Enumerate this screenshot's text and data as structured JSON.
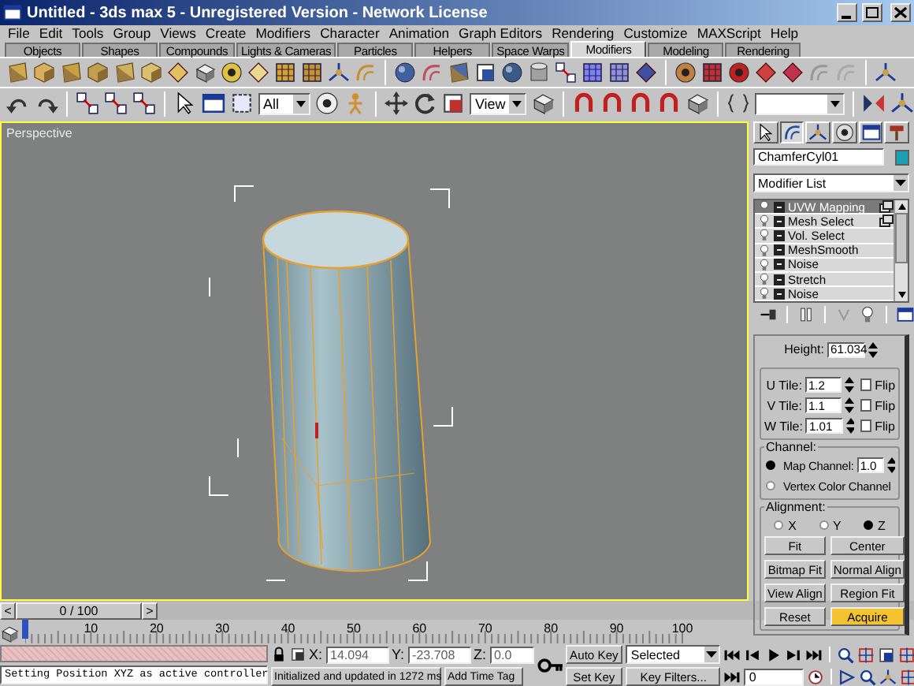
{
  "window": {
    "title": "Untitled - 3ds max 5 - Unregistered Version - Network License"
  },
  "menu": [
    "File",
    "Edit",
    "Tools",
    "Group",
    "Views",
    "Create",
    "Modifiers",
    "Character",
    "Animation",
    "Graph Editors",
    "Rendering",
    "Customize",
    "MAXScript",
    "Help"
  ],
  "tabs": [
    {
      "label": "Objects",
      "selected": false
    },
    {
      "label": "Shapes",
      "selected": false
    },
    {
      "label": "Compounds",
      "selected": false
    },
    {
      "label": "Lights & Cameras",
      "selected": false
    },
    {
      "label": "Particles",
      "selected": false
    },
    {
      "label": "Helpers",
      "selected": false
    },
    {
      "label": "Space Warps",
      "selected": false
    },
    {
      "label": "Modifiers",
      "selected": true
    },
    {
      "label": "Modeling",
      "selected": false
    },
    {
      "label": "Rendering",
      "selected": false
    }
  ],
  "main_toolbar": {
    "selection_filter": "All",
    "coordinate_system": "View"
  },
  "viewport": {
    "label": "Perspective",
    "active": true
  },
  "command_panel": {
    "object": {
      "name": "ChamferCyl01",
      "color": "#1aa0b4"
    },
    "modifier_list": "Modifier List",
    "stack": [
      {
        "name": "UVW Mapping",
        "selected": true,
        "instanced": true
      },
      {
        "name": "Mesh Select",
        "selected": false,
        "instanced": true
      },
      {
        "name": "Vol. Select",
        "selected": false,
        "instanced": false
      },
      {
        "name": "MeshSmooth",
        "selected": false,
        "instanced": false
      },
      {
        "name": "Noise",
        "selected": false,
        "instanced": false
      },
      {
        "name": "Stretch",
        "selected": false,
        "instanced": false
      },
      {
        "name": "Noise",
        "selected": false,
        "instanced": false
      }
    ],
    "height": {
      "label": "Height:",
      "value": "61.034"
    },
    "tiles": [
      {
        "label": "U Tile:",
        "value": "1.2",
        "flip_label": "Flip",
        "flip": false
      },
      {
        "label": "V Tile:",
        "value": "1.1",
        "flip_label": "Flip",
        "flip": false
      },
      {
        "label": "W Tile:",
        "value": "1.01",
        "flip_label": "Flip",
        "flip": false
      }
    ],
    "channel": {
      "title": "Channel:",
      "options": [
        {
          "label": "Map Channel:",
          "selected": true,
          "value": "1.0"
        },
        {
          "label": "Vertex Color Channel",
          "selected": false
        }
      ]
    },
    "alignment": {
      "title": "Alignment:",
      "axes": [
        {
          "label": "X",
          "selected": false
        },
        {
          "label": "Y",
          "selected": false
        },
        {
          "label": "Z",
          "selected": true
        }
      ],
      "buttons": [
        {
          "label": "Fit",
          "on": false
        },
        {
          "label": "Center",
          "on": false
        },
        {
          "label": "Bitmap Fit",
          "on": false
        },
        {
          "label": "Normal Align",
          "on": false
        },
        {
          "label": "View Align",
          "on": false
        },
        {
          "label": "Region Fit",
          "on": false
        },
        {
          "label": "Reset",
          "on": false
        },
        {
          "label": "Acquire",
          "on": true
        }
      ]
    }
  },
  "time_slider": {
    "prev": "<",
    "label": "0 / 100",
    "next": ">",
    "level": 0
  },
  "track_bar": {
    "ticks": [
      "10",
      "20",
      "30",
      "40",
      "50",
      "60",
      "70",
      "80",
      "90",
      "100"
    ]
  },
  "status": {
    "message": "Setting Position XYZ as active controller",
    "x": {
      "label": "X:",
      "value": "14.094"
    },
    "y": {
      "label": "Y:",
      "value": "-23.708"
    },
    "z": {
      "label": "Z:",
      "value": "0.0"
    },
    "info": "Initialized and updated in 1272 ms",
    "time_tag": "Add Time Tag",
    "auto_key": "Auto Key",
    "key_mode": "Selected",
    "set_key": "Set Key",
    "key_filters": "Key Filters...",
    "frame": "0"
  }
}
